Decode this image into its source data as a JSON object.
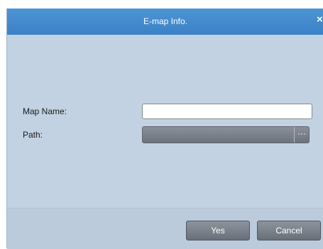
{
  "dialog": {
    "title": "E-map Info.",
    "close_glyph": "×",
    "close_icon": "close-icon"
  },
  "form": {
    "map_name_label": "Map Name:",
    "map_name_value": "",
    "path_label": "Path:",
    "path_value": "",
    "browse_glyph": "···",
    "browse_icon": "ellipsis-icon"
  },
  "buttons": {
    "yes_label": "Yes",
    "cancel_label": "Cancel"
  },
  "colors": {
    "titlebar": "#3f88ca",
    "dialog_background": "#c2d2e2",
    "button": "#7a8089"
  }
}
